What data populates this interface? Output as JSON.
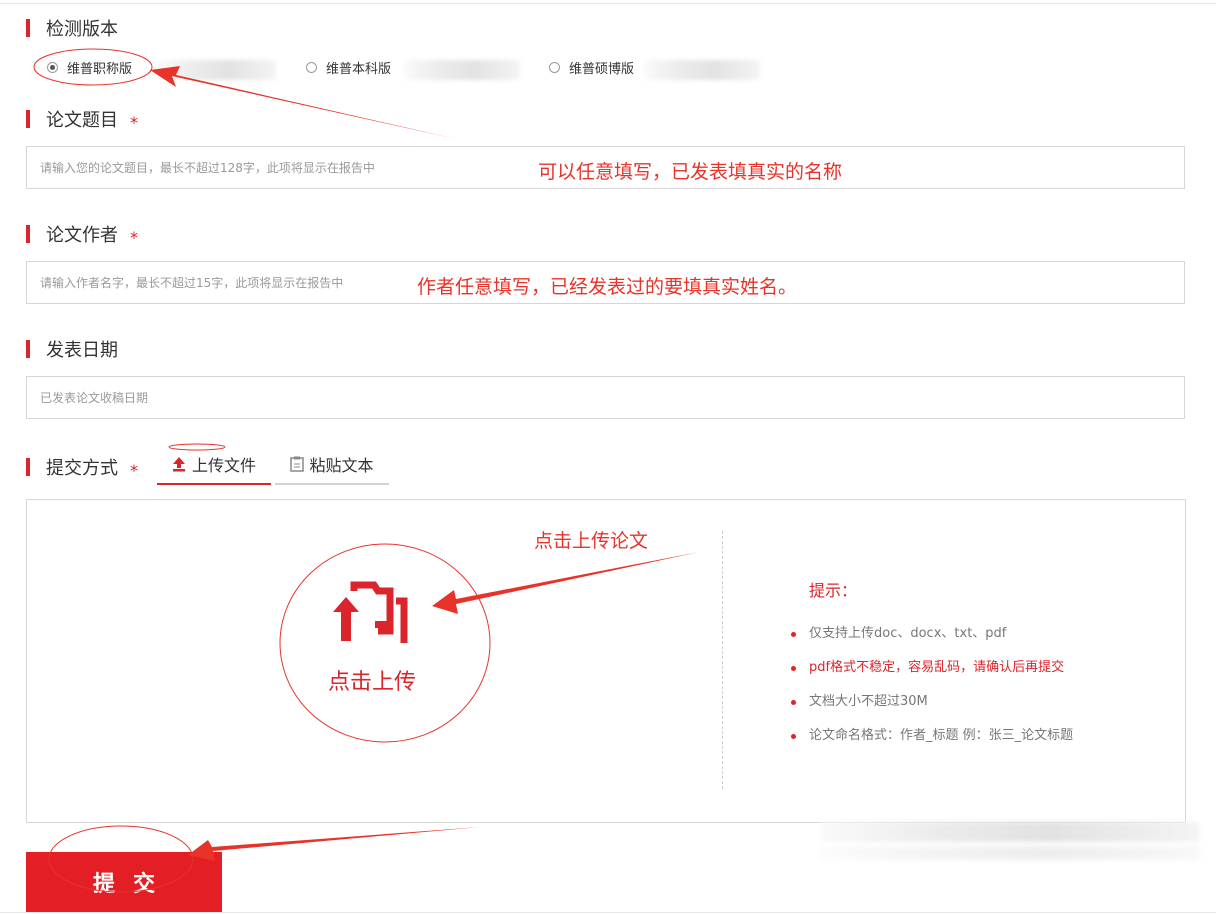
{
  "version": {
    "title": "检测版本",
    "options": [
      {
        "label": "维普职称版",
        "selected": true
      },
      {
        "label": "维普本科版",
        "selected": false
      },
      {
        "label": "维普硕博版",
        "selected": false
      }
    ]
  },
  "paper_title": {
    "label": "论文题目",
    "required_mark": "*",
    "placeholder": "请输入您的论文题目，最长不超过128字，此项将显示在报告中",
    "annotation": "可以任意填写，已发表填真实的名称"
  },
  "paper_author": {
    "label": "论文作者",
    "required_mark": "*",
    "placeholder": "请输入作者名字，最长不超过15字，此项将显示在报告中",
    "annotation": "作者任意填写，已经发表过的要填真实姓名。"
  },
  "publish_date": {
    "label": "发表日期",
    "placeholder": "已发表论文收稿日期"
  },
  "submit_method": {
    "label": "提交方式",
    "required_mark": "*",
    "tabs": [
      {
        "label": "上传文件",
        "icon": "upload-icon",
        "active": true
      },
      {
        "label": "粘贴文本",
        "icon": "clipboard-icon",
        "active": false
      }
    ]
  },
  "upload": {
    "button_label": "点击上传",
    "icon": "folder-upload-icon",
    "annotation": "点击上传论文"
  },
  "tips": {
    "title": "提示：",
    "items": [
      {
        "text": "仅支持上传doc、docx、txt、pdf",
        "warn": false
      },
      {
        "text": "pdf格式不稳定，容易乱码，请确认后再提交",
        "warn": true
      },
      {
        "text": "文档大小不超过30M",
        "warn": false
      },
      {
        "text": "论文命名格式：作者_标题 例：张三_论文标题",
        "warn": false
      }
    ]
  },
  "submit": {
    "label": "提交"
  },
  "colors": {
    "accent": "#e31e25",
    "annotation": "#e8332a",
    "border": "#d6d6d6"
  }
}
